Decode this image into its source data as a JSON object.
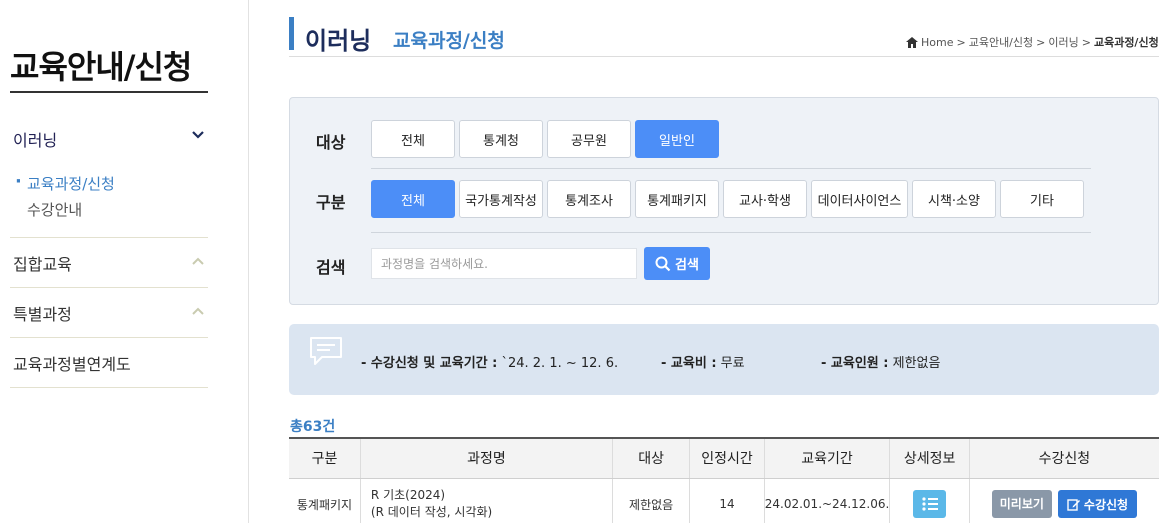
{
  "sidebar": {
    "title": "교육안내/신청",
    "items": [
      {
        "label": "이러닝",
        "open": true,
        "sub": [
          {
            "label": "교육과정/신청",
            "active": true
          },
          {
            "label": "수강안내",
            "active": false
          }
        ]
      },
      {
        "label": "집합교육"
      },
      {
        "label": "특별과정"
      },
      {
        "label": "교육과정별연계도"
      }
    ]
  },
  "header": {
    "title": "이러닝",
    "subtitle": "교육과정/신청",
    "breadcrumb": [
      "Home",
      "교육안내/신청",
      "이러닝",
      "교육과정/신청"
    ]
  },
  "filter": {
    "target_label": "대상",
    "target_options": [
      "전체",
      "통계청",
      "공무원",
      "일반인"
    ],
    "target_selected": "일반인",
    "category_label": "구분",
    "category_options": [
      "전체",
      "국가통계작성",
      "통계조사",
      "통계패키지",
      "교사·학생",
      "데이터사이언스",
      "시책·소양",
      "기타"
    ],
    "category_selected": "전체",
    "search_label": "검색",
    "search_placeholder": "과정명을 검색하세요.",
    "search_button": "검색"
  },
  "info": {
    "period_label": "- 수강신청 및 교육기간 :",
    "period_value": "`24. 2. 1. ~ 12. 6.",
    "fee_label": "- 교육비 :",
    "fee_value": "무료",
    "capacity_label": "- 교육인원 :",
    "capacity_value": "제한없음"
  },
  "count": {
    "prefix": "총",
    "number": "63",
    "suffix": "건"
  },
  "table": {
    "headers": [
      "구분",
      "과정명",
      "대상",
      "인정시간",
      "교육기간",
      "상세정보",
      "수강신청"
    ],
    "rows": [
      {
        "category": "통계패키지",
        "course_line1": "R 기초(2024)",
        "course_line2": "(R 데이터 작성, 시각화)",
        "target": "제한없음",
        "hours": "14",
        "period": "24.02.01.~24.12.06.",
        "preview": "미리보기",
        "apply": "수강신청"
      }
    ]
  },
  "colors": {
    "accent": "#3b7fc4",
    "button_on": "#4c8ef7",
    "apply": "#2f78d6",
    "detail": "#5bb8e8"
  }
}
